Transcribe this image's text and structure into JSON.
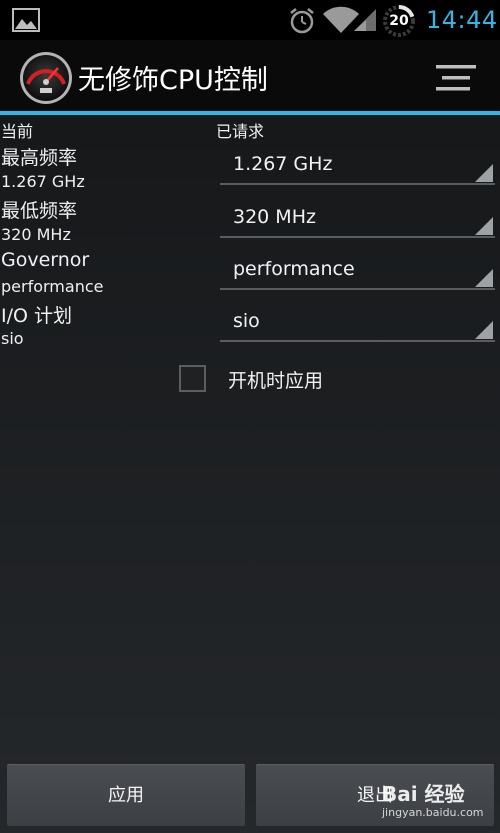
{
  "status_bar": {
    "time": "14:44",
    "battery_level": "20",
    "icons": [
      "gallery-icon",
      "alarm-icon",
      "wifi-icon",
      "signal-icon",
      "battery-icon"
    ]
  },
  "app": {
    "title": "无修饰CPU控制",
    "icon": "speedometer-icon",
    "menu_icon": "overflow-menu-icon"
  },
  "columns": {
    "current": "当前",
    "requested": "已请求"
  },
  "rows": [
    {
      "name": "最高频率",
      "current": "1.267 GHz",
      "requested": "1.267 GHz"
    },
    {
      "name": "最低频率",
      "current": "320 MHz",
      "requested": "320 MHz"
    },
    {
      "name": "Governor",
      "current": "performance",
      "requested": "performance"
    },
    {
      "name": "I/O 计划",
      "current": "sio",
      "requested": "sio"
    }
  ],
  "apply_on_boot": {
    "label": "开机时应用",
    "checked": false
  },
  "buttons": {
    "apply": "应用",
    "exit": "退出"
  },
  "watermark": {
    "logo": "Bai 经验",
    "url": "jingyan.baidu.com"
  },
  "colors": {
    "accent": "#33b5e5",
    "background": "#1b1d1f"
  }
}
